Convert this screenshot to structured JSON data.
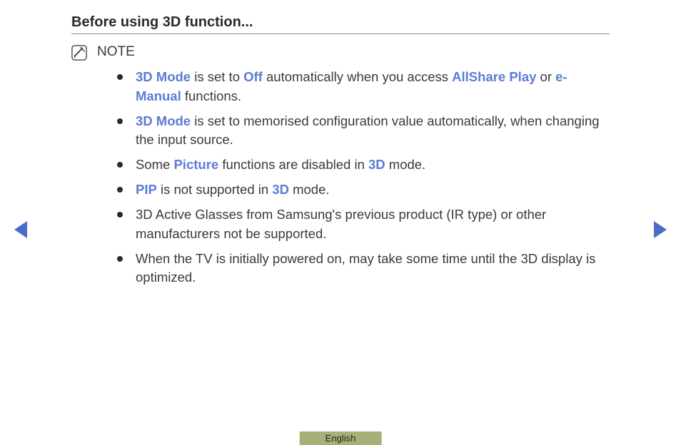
{
  "heading": "Before using 3D function...",
  "note_label": "NOTE",
  "bullets": [
    {
      "segments": [
        {
          "t": "3D Mode",
          "hl": true
        },
        {
          "t": " is set to "
        },
        {
          "t": "Off",
          "hl": true
        },
        {
          "t": " automatically when you access "
        },
        {
          "t": "AllShare Play",
          "hl": true
        },
        {
          "t": " or "
        },
        {
          "t": "e-Manual",
          "hl": true
        },
        {
          "t": " functions."
        }
      ]
    },
    {
      "segments": [
        {
          "t": "3D Mode",
          "hl": true
        },
        {
          "t": " is set to memorised configuration value automatically, when changing the input source."
        }
      ]
    },
    {
      "segments": [
        {
          "t": "Some "
        },
        {
          "t": "Picture",
          "hl": true
        },
        {
          "t": " functions are disabled in "
        },
        {
          "t": "3D",
          "hl": true
        },
        {
          "t": " mode."
        }
      ]
    },
    {
      "segments": [
        {
          "t": "PIP",
          "hl": true
        },
        {
          "t": " is not supported in "
        },
        {
          "t": "3D",
          "hl": true
        },
        {
          "t": " mode."
        }
      ]
    },
    {
      "segments": [
        {
          "t": "3D Active Glasses from Samsung's previous product (IR type) or other manufacturers not be supported."
        }
      ]
    },
    {
      "segments": [
        {
          "t": "When the TV is initially powered on, may take some time until the 3D display is optimized."
        }
      ]
    }
  ],
  "language": "English"
}
